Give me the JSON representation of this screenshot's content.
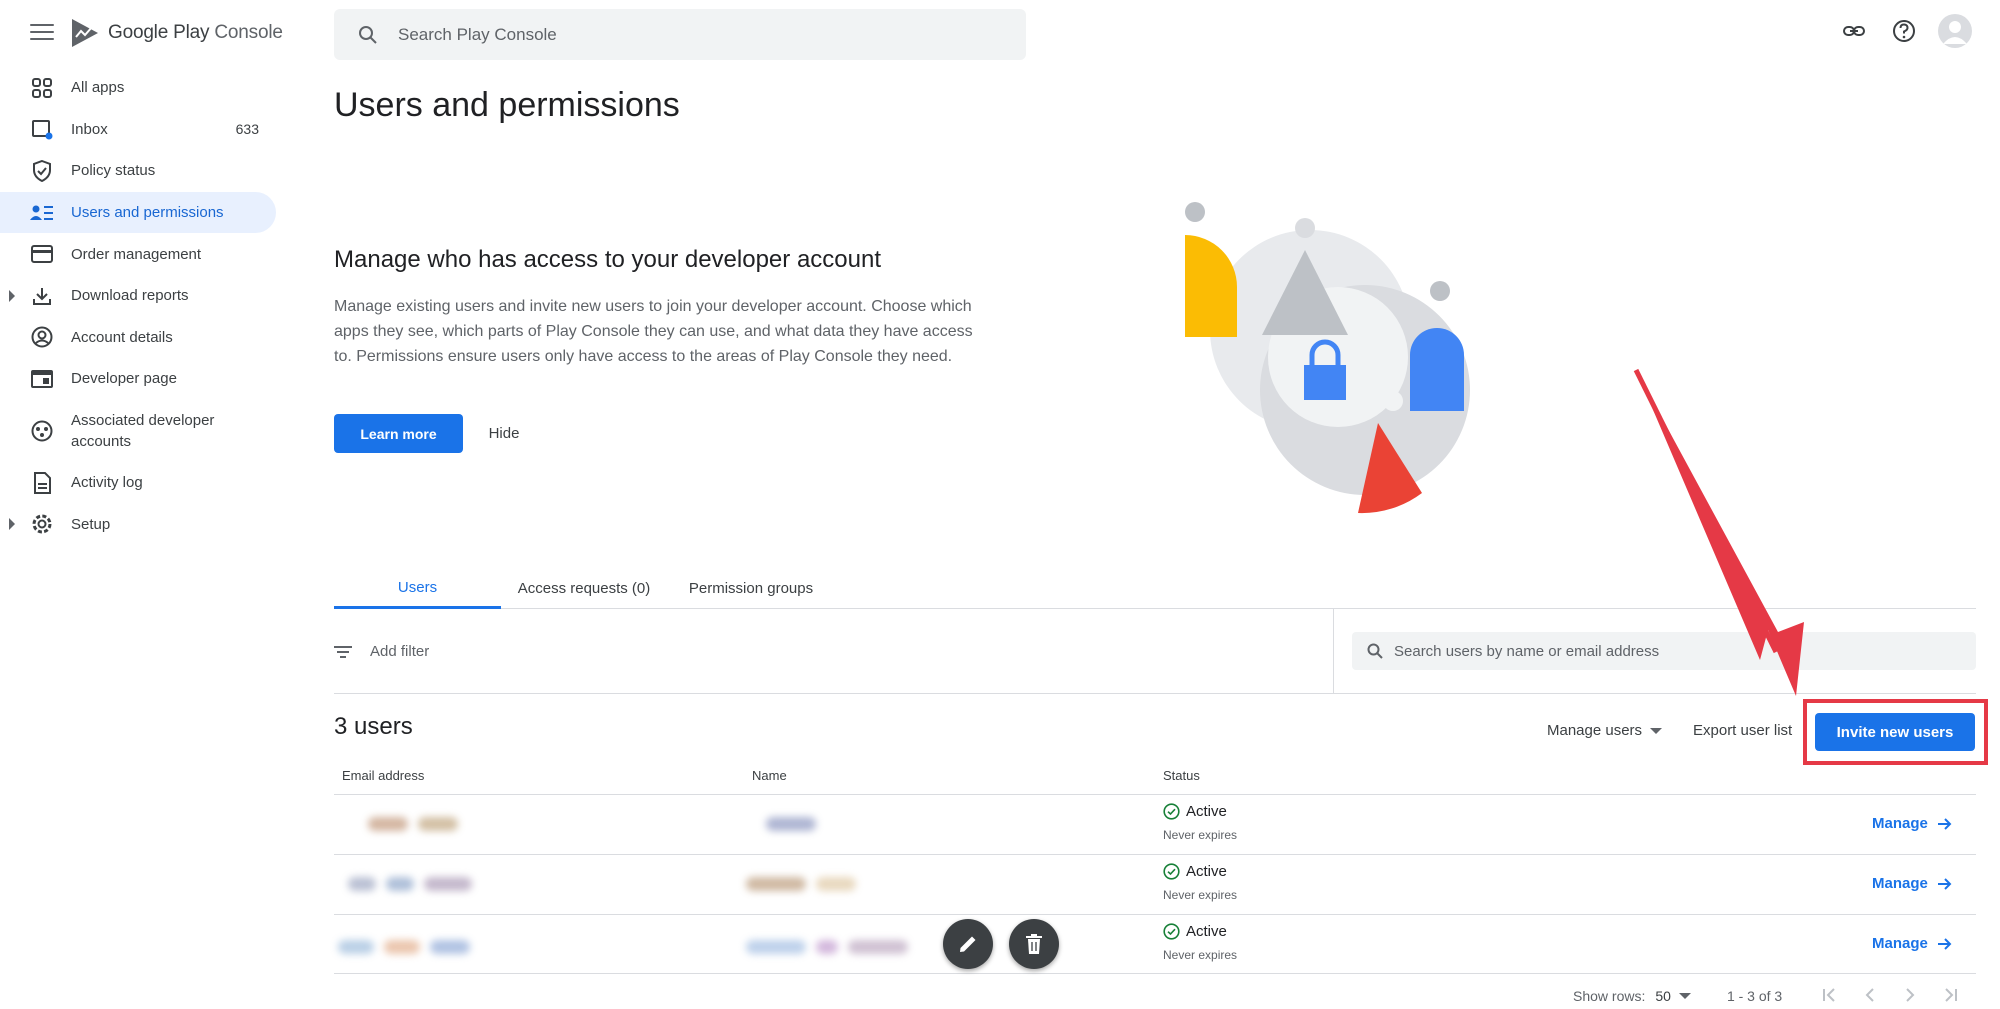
{
  "app": {
    "logo_text_1": "Google Play",
    "logo_text_2": "Console"
  },
  "top": {
    "search_placeholder": "Search Play Console"
  },
  "sidebar": {
    "items": [
      {
        "label": "All apps"
      },
      {
        "label": "Inbox",
        "count": "633"
      },
      {
        "label": "Policy status"
      },
      {
        "label": "Users and permissions"
      },
      {
        "label": "Order management"
      },
      {
        "label": "Download reports"
      },
      {
        "label": "Account details"
      },
      {
        "label": "Developer page"
      },
      {
        "label": "Associated developer accounts"
      },
      {
        "label": "Activity log"
      },
      {
        "label": "Setup"
      }
    ]
  },
  "main": {
    "page_title": "Users and permissions",
    "hero": {
      "title": "Manage who has access to your developer account",
      "description": "Manage existing users and invite new users to join your developer account. Choose which apps they see, which parts of Play Console they can use, and what data they have access to. Permissions ensure users only have access to the areas of Play Console they need.",
      "learn_more": "Learn more",
      "hide": "Hide"
    },
    "tabs": [
      {
        "label": "Users"
      },
      {
        "label": "Access requests (0)"
      },
      {
        "label": "Permission groups"
      }
    ],
    "filter": {
      "add_filter": "Add filter",
      "search_placeholder": "Search users by name or email address"
    },
    "users_count": "3 users",
    "actions": {
      "manage_users": "Manage users",
      "export": "Export user list",
      "invite": "Invite new users"
    },
    "columns": {
      "email": "Email address",
      "name": "Name",
      "status": "Status"
    },
    "rows": [
      {
        "status": "Active",
        "expiry": "Never expires",
        "action": "Manage"
      },
      {
        "status": "Active",
        "expiry": "Never expires",
        "action": "Manage"
      },
      {
        "status": "Active",
        "expiry": "Never expires",
        "action": "Manage"
      }
    ],
    "pagination": {
      "show_rows_label": "Show rows:",
      "rows_value": "50",
      "range": "1 - 3 of 3"
    }
  },
  "colors": {
    "accent": "#1a73e8",
    "highlight": "#e53946",
    "active_nav_bg": "#e8f0fe"
  }
}
